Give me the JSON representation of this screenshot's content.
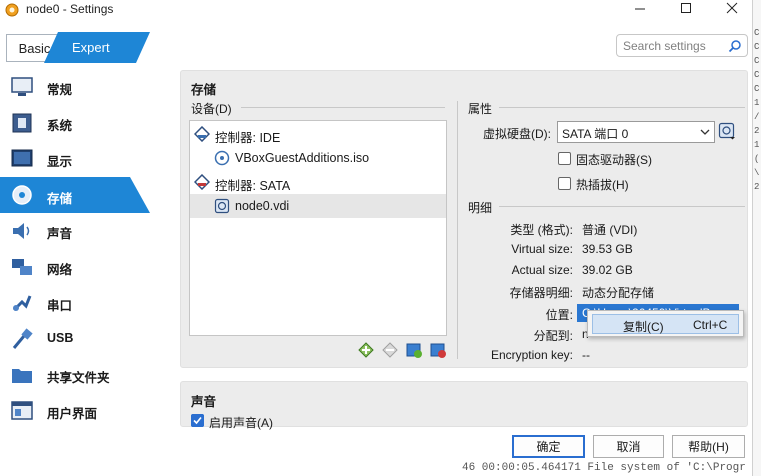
{
  "window": {
    "title": "node0 - Settings"
  },
  "mode": {
    "basic": "Basic",
    "expert": "Expert"
  },
  "search": {
    "placeholder": "Search settings"
  },
  "sidebar": {
    "items": [
      {
        "label": "常规"
      },
      {
        "label": "系统"
      },
      {
        "label": "显示"
      },
      {
        "label": "存储"
      },
      {
        "label": "声音"
      },
      {
        "label": "网络"
      },
      {
        "label": "串口"
      },
      {
        "label": "USB"
      },
      {
        "label": "共享文件夹"
      },
      {
        "label": "用户界面"
      }
    ]
  },
  "storage": {
    "title": "存储",
    "devices_label": "设备(D)",
    "tree": [
      {
        "label": "控制器: IDE"
      },
      {
        "label": "VBoxGuestAdditions.iso"
      },
      {
        "label": "控制器: SATA"
      },
      {
        "label": "node0.vdi"
      }
    ]
  },
  "attributes": {
    "title": "属性",
    "virtual_disk_label": "虚拟硬盘(D):",
    "virtual_disk_value": "SATA 端口 0",
    "ssd_label": "固态驱动器(S)",
    "hotplug_label": "热插拔(H)"
  },
  "info": {
    "title": "明细",
    "rows": [
      {
        "key": "类型 (格式):",
        "value": "普通 (VDI)"
      },
      {
        "key": "Virtual size:",
        "value": "39.53 GB"
      },
      {
        "key": "Actual size:",
        "value": "39.02 GB"
      },
      {
        "key": "存储器明细:",
        "value": "动态分配存储"
      },
      {
        "key": "位置:",
        "value": "C:\\Users\\26459\\VirtualBo"
      },
      {
        "key": "分配到:",
        "value": "n"
      },
      {
        "key": "Encryption key:",
        "value": "--"
      }
    ]
  },
  "context_menu": {
    "copy": "复制(C)",
    "shortcut": "Ctrl+C"
  },
  "audio": {
    "title": "声音",
    "enable_label": "启用声音(A)"
  },
  "buttons": {
    "ok": "确定",
    "cancel": "取消",
    "help": "帮助(H)"
  },
  "background_terminal": {
    "bottom_line": "46 00:00:05.464171 File system of 'C:\\Progr",
    "edge_chars": [
      "C",
      "C",
      "C",
      "C",
      "C",
      "1",
      "/",
      "2",
      "1",
      "(",
      "\\",
      "2"
    ]
  }
}
